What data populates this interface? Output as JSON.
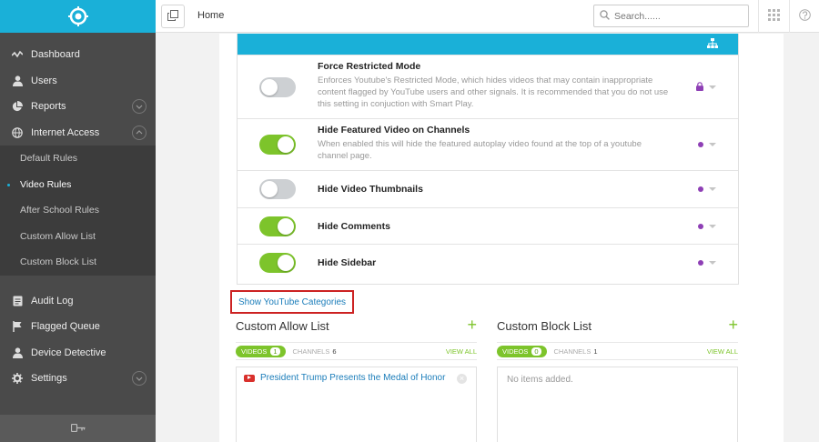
{
  "sidebar": {
    "logo": "brand-logo",
    "items": [
      {
        "label": "Dashboard",
        "icon": "activity-icon"
      },
      {
        "label": "Users",
        "icon": "user-icon"
      },
      {
        "label": "Reports",
        "icon": "pie-chart-icon",
        "chevron": "down"
      },
      {
        "label": "Internet Access",
        "icon": "globe-icon",
        "chevron": "up"
      }
    ],
    "sub_items": [
      {
        "label": "Default Rules"
      },
      {
        "label": "Video Rules",
        "active": true
      },
      {
        "label": "After School Rules"
      },
      {
        "label": "Custom Allow List"
      },
      {
        "label": "Custom Block List"
      }
    ],
    "items_bottom": [
      {
        "label": "Audit Log",
        "icon": "document-icon"
      },
      {
        "label": "Flagged Queue",
        "icon": "flag-icon"
      },
      {
        "label": "Device Detective",
        "icon": "user-icon"
      },
      {
        "label": "Settings",
        "icon": "gear-icon",
        "chevron": "down"
      }
    ],
    "footer_icon": "key-icon"
  },
  "topbar": {
    "title": "Home",
    "search_placeholder": "Search......"
  },
  "rules": [
    {
      "title": "Force Restricted Mode",
      "description": "Enforces Youtube's Restricted Mode, which hides videos that may contain inappropriate content flagged by YouTube users and other signals. It is recommended that you do not use this setting in conjuction with Smart Play.",
      "enabled": false,
      "indicator": "lock"
    },
    {
      "title": "Hide Featured Video on Channels",
      "description": "When enabled this will hide the featured autoplay video found at the top of a youtube channel page.",
      "enabled": true,
      "indicator": "dot"
    },
    {
      "title": "Hide Video Thumbnails",
      "description": "",
      "enabled": false,
      "indicator": "dot"
    },
    {
      "title": "Hide Comments",
      "description": "",
      "enabled": true,
      "indicator": "dot"
    },
    {
      "title": "Hide Sidebar",
      "description": "",
      "enabled": true,
      "indicator": "dot"
    }
  ],
  "categories_link": "Show YouTube Categories",
  "allow_panel": {
    "title": "Custom Allow List",
    "videos_label": "VIDEOS",
    "videos_count": "1",
    "channels_label": "CHANNELS",
    "channels_count": "6",
    "view_all": "VIEW ALL",
    "entry": "President Trump Presents the Medal of Honor"
  },
  "block_panel": {
    "title": "Custom Block List",
    "videos_label": "VIDEOS",
    "videos_count": "0",
    "channels_label": "CHANNELS",
    "channels_count": "1",
    "view_all": "VIEW ALL",
    "empty_text": "No items added."
  },
  "colors": {
    "accent": "#1ab0d8",
    "green": "#7dc42b",
    "purple": "#8e3fb5",
    "sidebar": "#4a4a4a",
    "highlight": "#cc2222"
  }
}
